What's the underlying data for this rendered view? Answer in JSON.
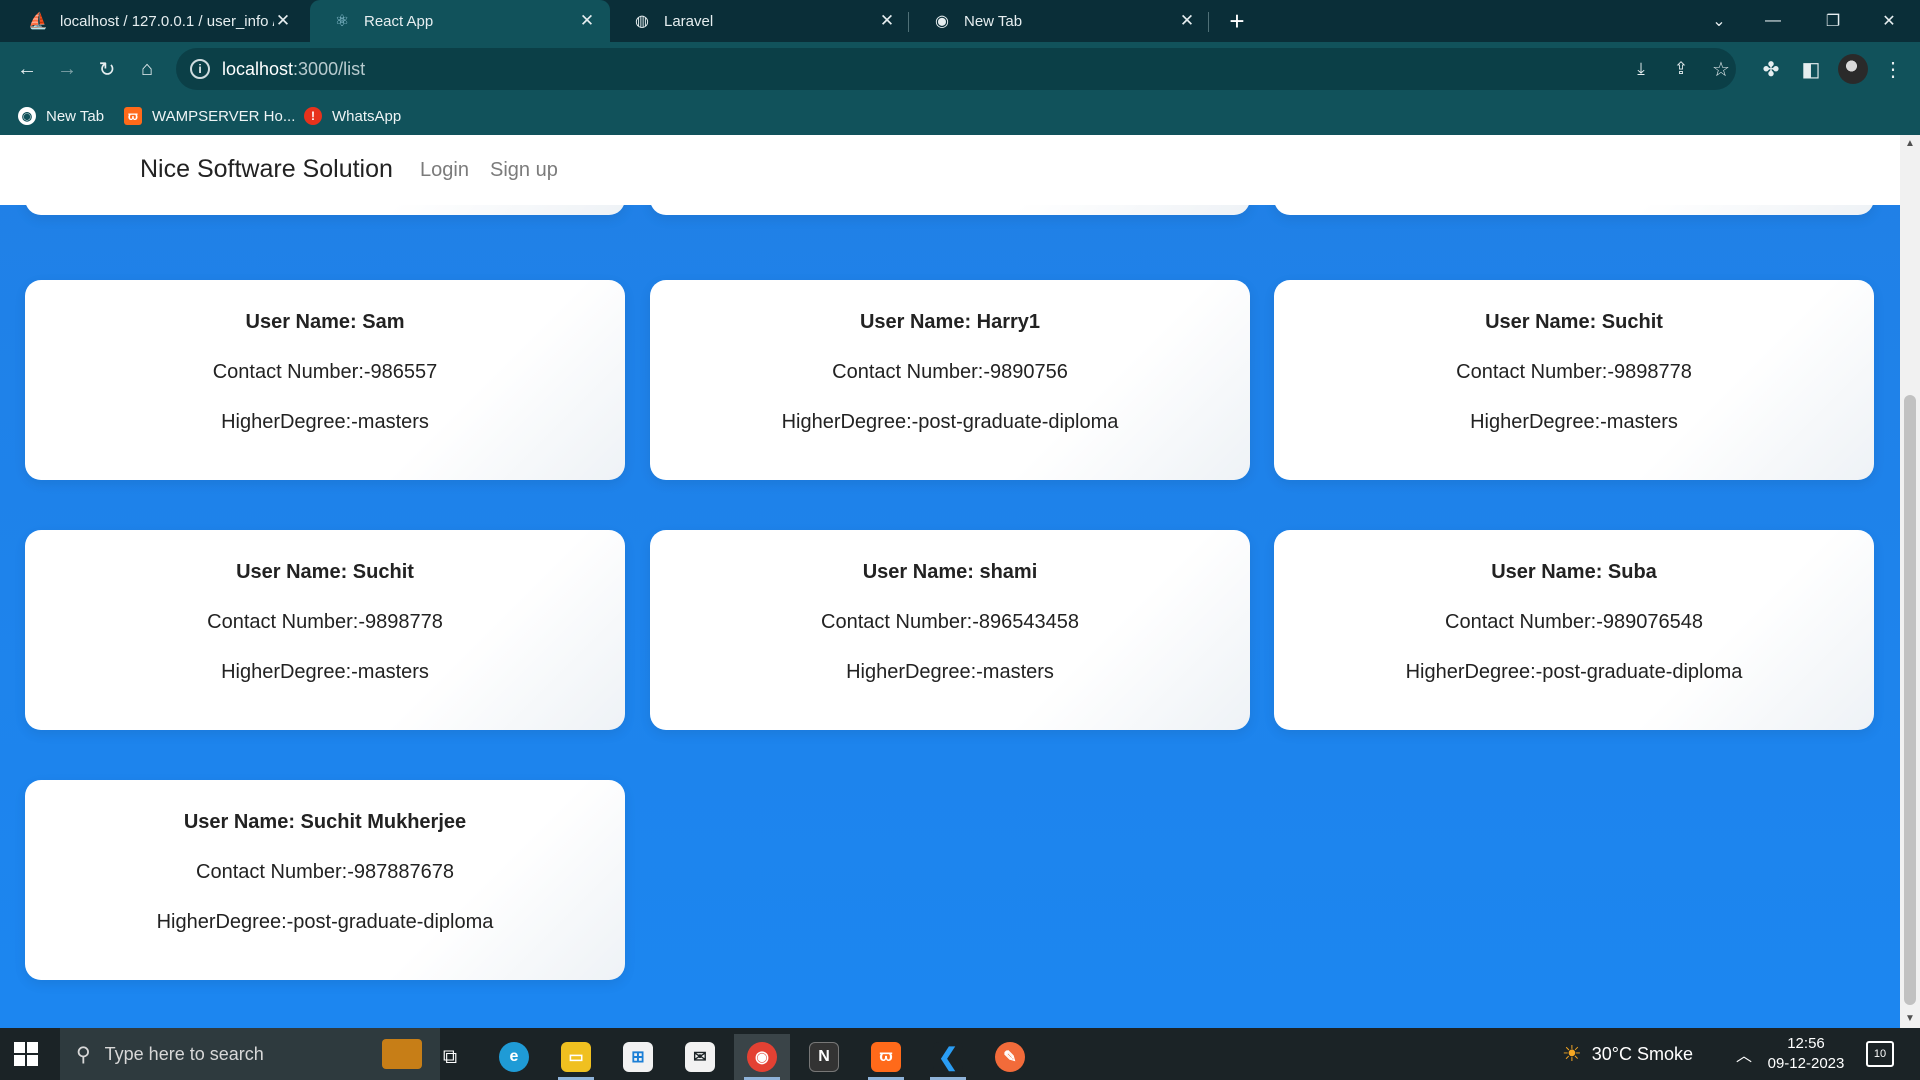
{
  "browser": {
    "tabs": [
      {
        "title": "localhost / 127.0.0.1 / user_info /",
        "icon": "phpmyadmin-icon",
        "active": false
      },
      {
        "title": "React App",
        "icon": "react-icon",
        "active": true
      },
      {
        "title": "Laravel",
        "icon": "globe-icon",
        "active": false
      },
      {
        "title": "New Tab",
        "icon": "chrome-icon",
        "active": false
      }
    ],
    "address": {
      "host": "localhost",
      "path": ":3000/list"
    },
    "bookmarks": [
      {
        "label": "New Tab",
        "icon": "chrome-icon"
      },
      {
        "label": "WAMPSERVER Ho...",
        "icon": "wampserver-icon"
      },
      {
        "label": "WhatsApp",
        "icon": "alert-icon"
      }
    ]
  },
  "navbar": {
    "brand": "Nice Software Solution",
    "links": [
      "Login",
      "Sign up"
    ]
  },
  "users": [
    {
      "name_label": "User Name: Sam",
      "contact_label": "Contact Number:-986557",
      "degree_label": "HigherDegree:-masters"
    },
    {
      "name_label": "User Name: Harry1",
      "contact_label": "Contact Number:-9890756",
      "degree_label": "HigherDegree:-post-graduate-diploma"
    },
    {
      "name_label": "User Name: Suchit",
      "contact_label": "Contact Number:-9898778",
      "degree_label": "HigherDegree:-masters"
    },
    {
      "name_label": "User Name: Suchit",
      "contact_label": "Contact Number:-9898778",
      "degree_label": "HigherDegree:-masters"
    },
    {
      "name_label": "User Name: shami",
      "contact_label": "Contact Number:-896543458",
      "degree_label": "HigherDegree:-masters"
    },
    {
      "name_label": "User Name: Suba",
      "contact_label": "Contact Number:-989076548",
      "degree_label": "HigherDegree:-post-graduate-diploma"
    },
    {
      "name_label": "User Name: Suchit Mukherjee",
      "contact_label": "Contact Number:-987887678",
      "degree_label": "HigherDegree:-post-graduate-diploma"
    }
  ],
  "taskbar": {
    "search_placeholder": "Type here to search",
    "weather": "30°C  Smoke",
    "time": "12:56",
    "date": "09-12-2023",
    "notifications": "10"
  },
  "colors": {
    "page_background": "#1f7fe6",
    "chrome_dark": "#0a2e38",
    "chrome_toolbar": "#11525b"
  }
}
